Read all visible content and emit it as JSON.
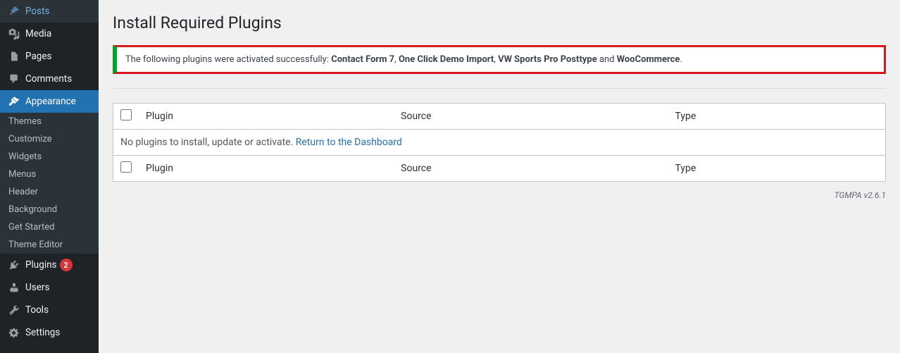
{
  "menu": {
    "posts": "Posts",
    "media": "Media",
    "pages": "Pages",
    "comments": "Comments",
    "appearance": "Appearance",
    "plugins": "Plugins",
    "plugins_count": "2",
    "users": "Users",
    "tools": "Tools",
    "settings": "Settings"
  },
  "submenu": {
    "themes": "Themes",
    "customize": "Customize",
    "widgets": "Widgets",
    "menus": "Menus",
    "header": "Header",
    "background": "Background",
    "get_started": "Get Started",
    "theme_editor": "Theme Editor"
  },
  "page": {
    "title": "Install Required Plugins",
    "notice_prefix": "The following plugins were activated successfully: ",
    "notice_p1": "Contact Form 7",
    "notice_s1": ", ",
    "notice_p2": "One Click Demo Import",
    "notice_s2": ", ",
    "notice_p3": "VW Sports Pro Posttype",
    "notice_s3": " and ",
    "notice_p4": "WooCommerce",
    "notice_end": ".",
    "empty_msg": "No plugins to install, update or activate. ",
    "return_link": "Return to the Dashboard",
    "version": "TGMPA v2.6.1"
  },
  "table": {
    "col_plugin": "Plugin",
    "col_source": "Source",
    "col_type": "Type"
  }
}
